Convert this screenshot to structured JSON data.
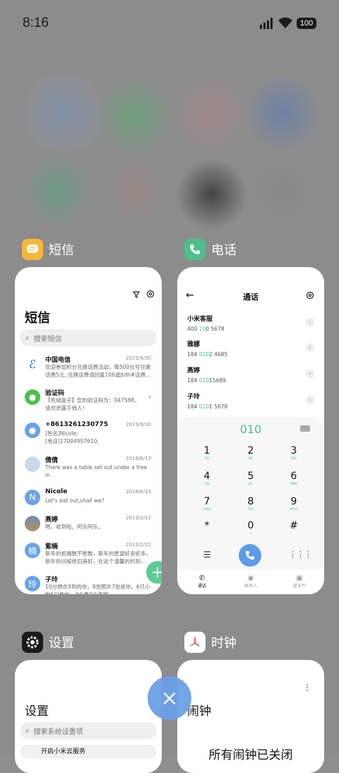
{
  "status_bar": {
    "time": "8:16",
    "battery": "100"
  },
  "apps": [
    {
      "name": "短信",
      "icon": "message-icon",
      "color": "#f5b83c"
    },
    {
      "name": "电话",
      "icon": "phone-icon",
      "color": "#4cc08a"
    },
    {
      "name": "设置",
      "icon": "gear-icon",
      "color": "#1a1a1a"
    },
    {
      "name": "时钟",
      "icon": "clock-icon",
      "color": "#ffffff"
    }
  ],
  "sms": {
    "title": "短信",
    "search_placeholder": "搜索短信",
    "messages": [
      {
        "name": "中国电信",
        "date": "2025/9/30",
        "preview": "欢迎参加积分兑换话费活动，每500分可兑换\n话费5元, 兑换话费请回复106或jtdh#话费...",
        "avatar": "telecom"
      },
      {
        "name": "验证码",
        "date": "",
        "preview": "【毛绒盒子】您的验证码为：047588，\n请勿泄露于他人！",
        "avatar": "chat"
      },
      {
        "name": "+8613261230775",
        "date": "2019/9/30",
        "preview": "[姓名]Nicole;\n[电话]17004957610;",
        "avatar": "person"
      },
      {
        "name": "倩倩",
        "date": "2016/6/13",
        "preview": "There was a table set out under a tree in\nfront of the house,and the March Hare an...",
        "avatar": "photo"
      },
      {
        "name": "Nicole",
        "date": "2016/6/13",
        "preview": "Let's eat out,shall we?",
        "avatar": "N"
      },
      {
        "name": "燕婷",
        "date": "2013/2/22",
        "preview": "嗯。收到啦。阿乐阿乐。",
        "avatar": "photo2"
      },
      {
        "name": "紫楠",
        "date": "2013/2/22",
        "preview": "新年的祝福数不胜数，新年的愿望好多好多，\n新年的问候依旧美好，在这个温馨的时刻...",
        "avatar": "楠"
      },
      {
        "name": "子玲",
        "date": "",
        "preview": "10分想念9到的你，8张照片7张是你，6只小\n狗5只像你，4个表3个不够...",
        "avatar": "玲"
      }
    ],
    "fab": "+"
  },
  "phone": {
    "title": "通话",
    "contacts": [
      {
        "name": "小米客服",
        "pre": "400 ",
        "hl": "10",
        "post": "0 5678"
      },
      {
        "name": "雅娜",
        "pre": "184 ",
        "hl": "010",
        "post": "2 4685"
      },
      {
        "name": "燕婷",
        "pre": "184 ",
        "hl": "010",
        "post": "15689"
      },
      {
        "name": "子玲",
        "pre": "184 ",
        "hl": "010",
        "post": "1 5678"
      }
    ],
    "dialed": "010",
    "keys": [
      {
        "d": "1",
        "l": "QQ"
      },
      {
        "d": "2",
        "l": "ABC"
      },
      {
        "d": "3",
        "l": "DEF"
      },
      {
        "d": "4",
        "l": "GHI"
      },
      {
        "d": "5",
        "l": "JKL"
      },
      {
        "d": "6",
        "l": "MNO"
      },
      {
        "d": "7",
        "l": "PQRS"
      },
      {
        "d": "8",
        "l": "TUV"
      },
      {
        "d": "9",
        "l": "WXYZ"
      },
      {
        "d": "*",
        "l": ""
      },
      {
        "d": "0",
        "l": "+"
      },
      {
        "d": "#",
        "l": ""
      }
    ],
    "tabs": [
      "通话",
      "联系人",
      "营业厅"
    ]
  },
  "settings": {
    "title": "设置",
    "search_placeholder": "搜索系统设置项",
    "first_row": "开启小米云服务"
  },
  "clock": {
    "title": "闹钟",
    "status": "所有闹钟已关闭"
  },
  "close_label": "×"
}
